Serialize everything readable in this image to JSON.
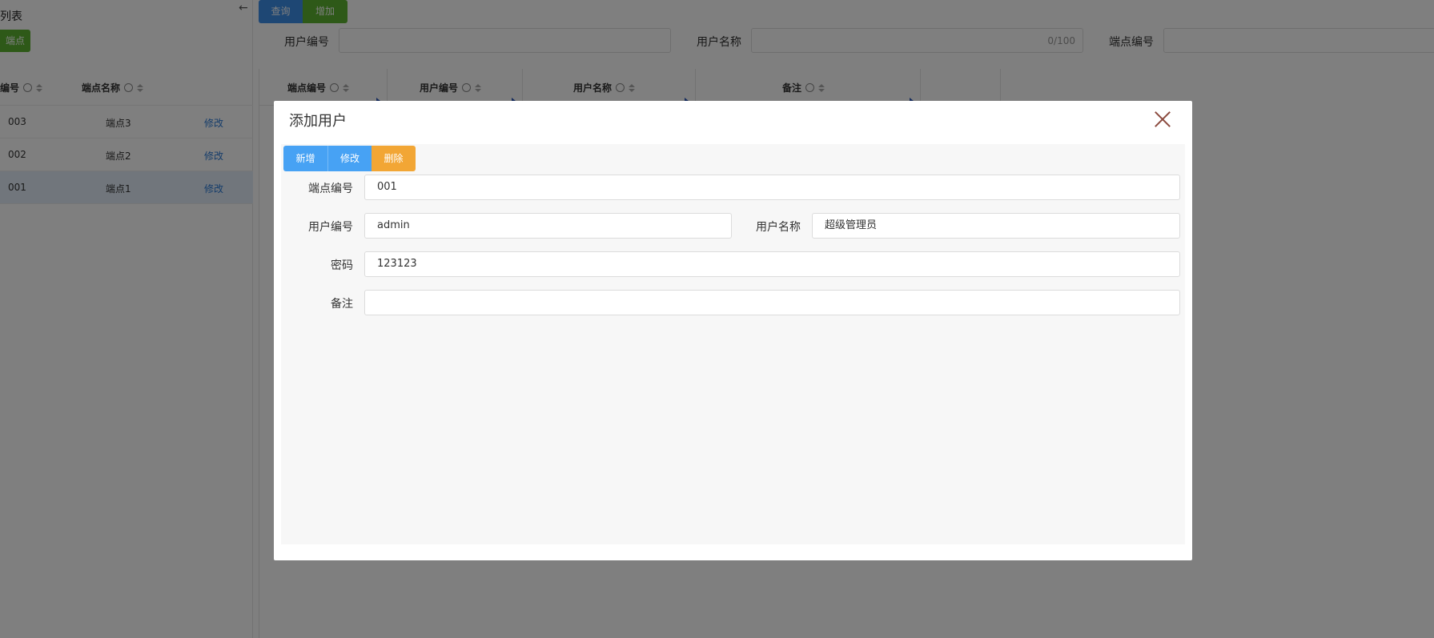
{
  "left_panel": {
    "title": "列表",
    "add_button": "端点",
    "columns": {
      "code": "编号",
      "name": "端点名称"
    },
    "rows": [
      {
        "code": "003",
        "name": "端点3",
        "action": "修改"
      },
      {
        "code": "002",
        "name": "端点2",
        "action": "修改"
      },
      {
        "code": "001",
        "name": "端点1",
        "action": "修改"
      }
    ]
  },
  "toolbar": {
    "back_icon": "←",
    "query": "查询",
    "add": "增加"
  },
  "filters": {
    "user_code_label": "用户编号",
    "user_name_label": "用户名称",
    "user_name_counter": "0/100",
    "site_code_label": "端点编号"
  },
  "grid": {
    "columns": [
      "端点编号",
      "用户编号",
      "用户名称",
      "备注"
    ]
  },
  "dialog": {
    "title": "添加用户",
    "buttons": {
      "new": "新增",
      "edit": "修改",
      "delete": "删除"
    },
    "fields": {
      "site_code_label": "端点编号",
      "site_code_value": "001",
      "user_code_label": "用户编号",
      "user_code_value": "admin",
      "user_name_label": "用户名称",
      "user_name_value": "超级管理员",
      "password_label": "密码",
      "password_value": "123123",
      "remark_label": "备注",
      "remark_value": ""
    }
  },
  "colors": {
    "primary": "#3c8ee8",
    "success": "#5cb331",
    "warning": "#f2a635",
    "link": "#2d7bd6"
  }
}
